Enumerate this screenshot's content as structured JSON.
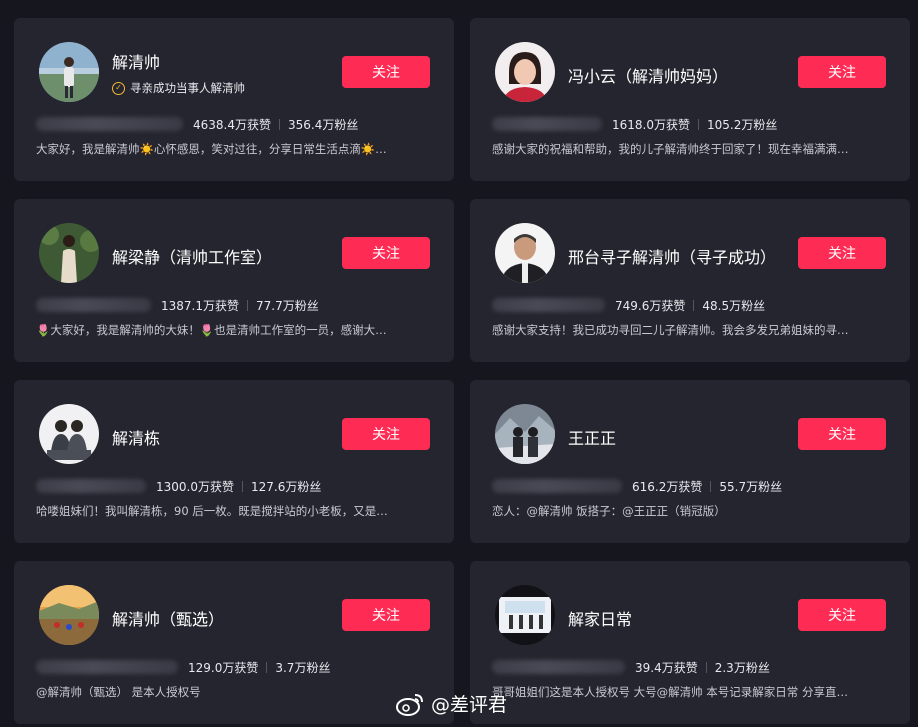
{
  "follow_label": "关注",
  "accent_color": "#fe2c55",
  "cards": [
    {
      "name": "解清帅",
      "verified": "寻亲成功当事人解清帅",
      "likes": "4638.4万获赞",
      "fans": "356.4万粉丝",
      "desc": "大家好，我是解清帅☀️心怀感恩，笑对过往，分享日常生活点滴☀️…"
    },
    {
      "name": "冯小云（解清帅妈妈）",
      "likes": "1618.0万获赞",
      "fans": "105.2万粉丝",
      "desc": "感谢大家的祝福和帮助，我的儿子解清帅终于回家了！现在幸福满满…"
    },
    {
      "name": "解梁静（清帅工作室）",
      "likes": "1387.1万获赞",
      "fans": "77.7万粉丝",
      "desc": "🌷大家好，我是解清帅的大妹！🌷也是清帅工作室的一员，感谢大…"
    },
    {
      "name": "邢台寻子解清帅（寻子成功）",
      "likes": "749.6万获赞",
      "fans": "48.5万粉丝",
      "desc": "感谢大家支持！我已成功寻回二儿子解清帅。我会多发兄弟姐妹的寻…"
    },
    {
      "name": "解清栋",
      "likes": "1300.0万获赞",
      "fans": "127.6万粉丝",
      "desc": "哈喽姐妹们！我叫解清栋，90 后一枚。既是搅拌站的小老板，又是…"
    },
    {
      "name": "王正正",
      "likes": "616.2万获赞",
      "fans": "55.7万粉丝",
      "desc": "恋人：@解清帅 饭搭子：@王正正（销冠版）"
    },
    {
      "name": "解清帅（甄选）",
      "likes": "129.0万获赞",
      "fans": "3.7万粉丝",
      "desc": "@解清帅（甄选） 是本人授权号"
    },
    {
      "name": "解家日常",
      "likes": "39.4万获赞",
      "fans": "2.3万粉丝",
      "desc": "哥哥姐姐们这是本人授权号 大号@解清帅 本号记录解家日常 分享直…"
    }
  ],
  "watermark": "@差评君"
}
